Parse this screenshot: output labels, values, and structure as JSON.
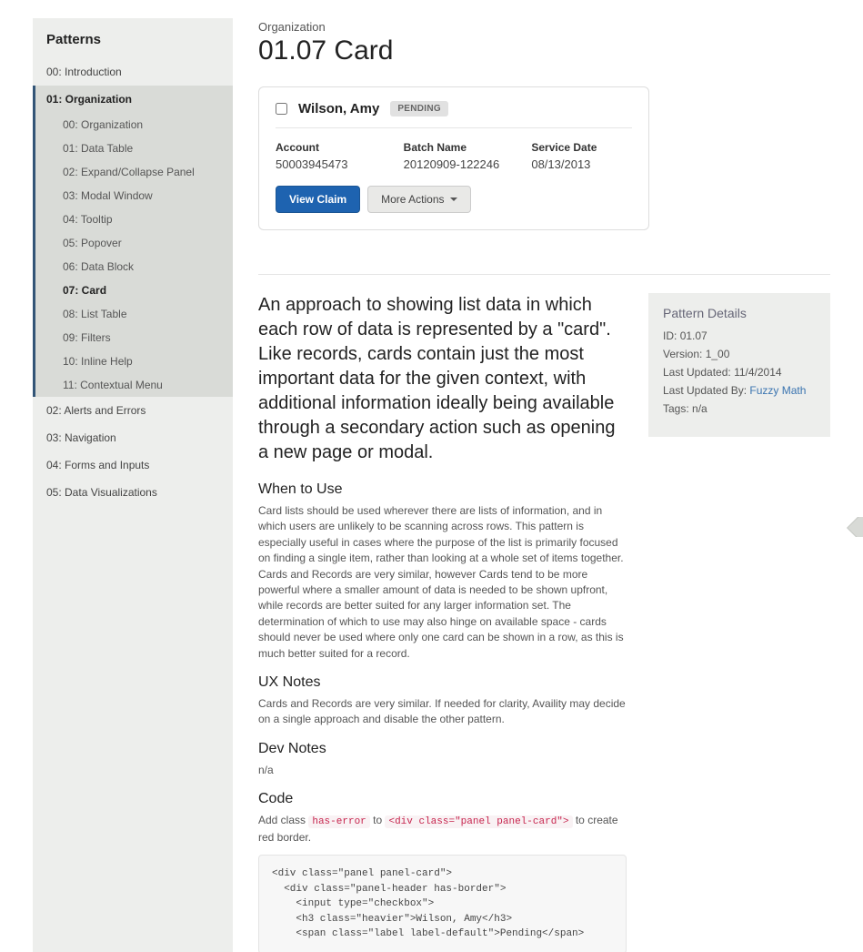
{
  "sidebar": {
    "title": "Patterns",
    "top": [
      {
        "label": "00: Introduction"
      },
      {
        "label": "01: Organization",
        "active": true
      },
      {
        "label": "02: Alerts and Errors"
      },
      {
        "label": "03: Navigation"
      },
      {
        "label": "04: Forms and Inputs"
      },
      {
        "label": "05: Data Visualizations"
      }
    ],
    "sub": [
      {
        "label": "00: Organization"
      },
      {
        "label": "01: Data Table"
      },
      {
        "label": "02: Expand/Collapse Panel"
      },
      {
        "label": "03: Modal Window"
      },
      {
        "label": "04: Tooltip"
      },
      {
        "label": "05: Popover"
      },
      {
        "label": "06: Data Block"
      },
      {
        "label": "07: Card",
        "active": true
      },
      {
        "label": "08: List Table"
      },
      {
        "label": "09: Filters"
      },
      {
        "label": "10: Inline Help"
      },
      {
        "label": "11: Contextual Menu"
      }
    ]
  },
  "breadcrumb": "Organization",
  "page_title": "01.07 Card",
  "card": {
    "name": "Wilson, Amy",
    "status": "PENDING",
    "fields": [
      {
        "label": "Account",
        "value": "50003945473"
      },
      {
        "label": "Batch Name",
        "value": "20120909-122246"
      },
      {
        "label": "Service Date",
        "value": "08/13/2013"
      }
    ],
    "view_button": "View Claim",
    "more_button": "More Actions"
  },
  "lead": "An approach to showing list data in which each row of data is represented by a \"card\". Like records, cards contain just the most important data for the given context, with additional information ideally being available through a secondary action such as opening a new page or modal.",
  "sections": {
    "when_h": "When to Use",
    "when_p": "Card lists should be used wherever there are lists of information, and in which users are unlikely to be scanning across rows. This pattern is especially useful in cases where the purpose of the list is primarily focused on finding a single item, rather than looking at a whole set of items together. Cards and Records are very similar, however Cards tend to be more powerful where a smaller amount of data is needed to be shown upfront, while records are better suited for any larger information set. The determination of which to use may also hinge on available space - cards should never be used where only one card can be shown in a row, as this is much better suited for a record.",
    "ux_h": "UX Notes",
    "ux_p": "Cards and Records are very similar. If needed for clarity, Availity may decide on a single approach and disable the other pattern.",
    "dev_h": "Dev Notes",
    "dev_p": "n/a",
    "code_h": "Code",
    "code_intro_pre": "Add class ",
    "code_intro_c1": "has-error",
    "code_intro_mid": " to ",
    "code_intro_c2": "<div class=\"panel panel-card\">",
    "code_intro_post": " to create red border.",
    "code_block": "<div class=\"panel panel-card\">\n  <div class=\"panel-header has-border\">\n    <input type=\"checkbox\">\n    <h3 class=\"heavier\">Wilson, Amy</h3>\n    <span class=\"label label-default\">Pending</span>"
  },
  "details": {
    "title": "Pattern Details",
    "id_label": "ID:",
    "id_value": "01.07",
    "version_label": "Version:",
    "version_value": "1_00",
    "updated_label": "Last Updated:",
    "updated_value": "11/4/2014",
    "by_label": "Last Updated By:",
    "by_value": "Fuzzy Math",
    "tags_label": "Tags:",
    "tags_value": "n/a"
  }
}
